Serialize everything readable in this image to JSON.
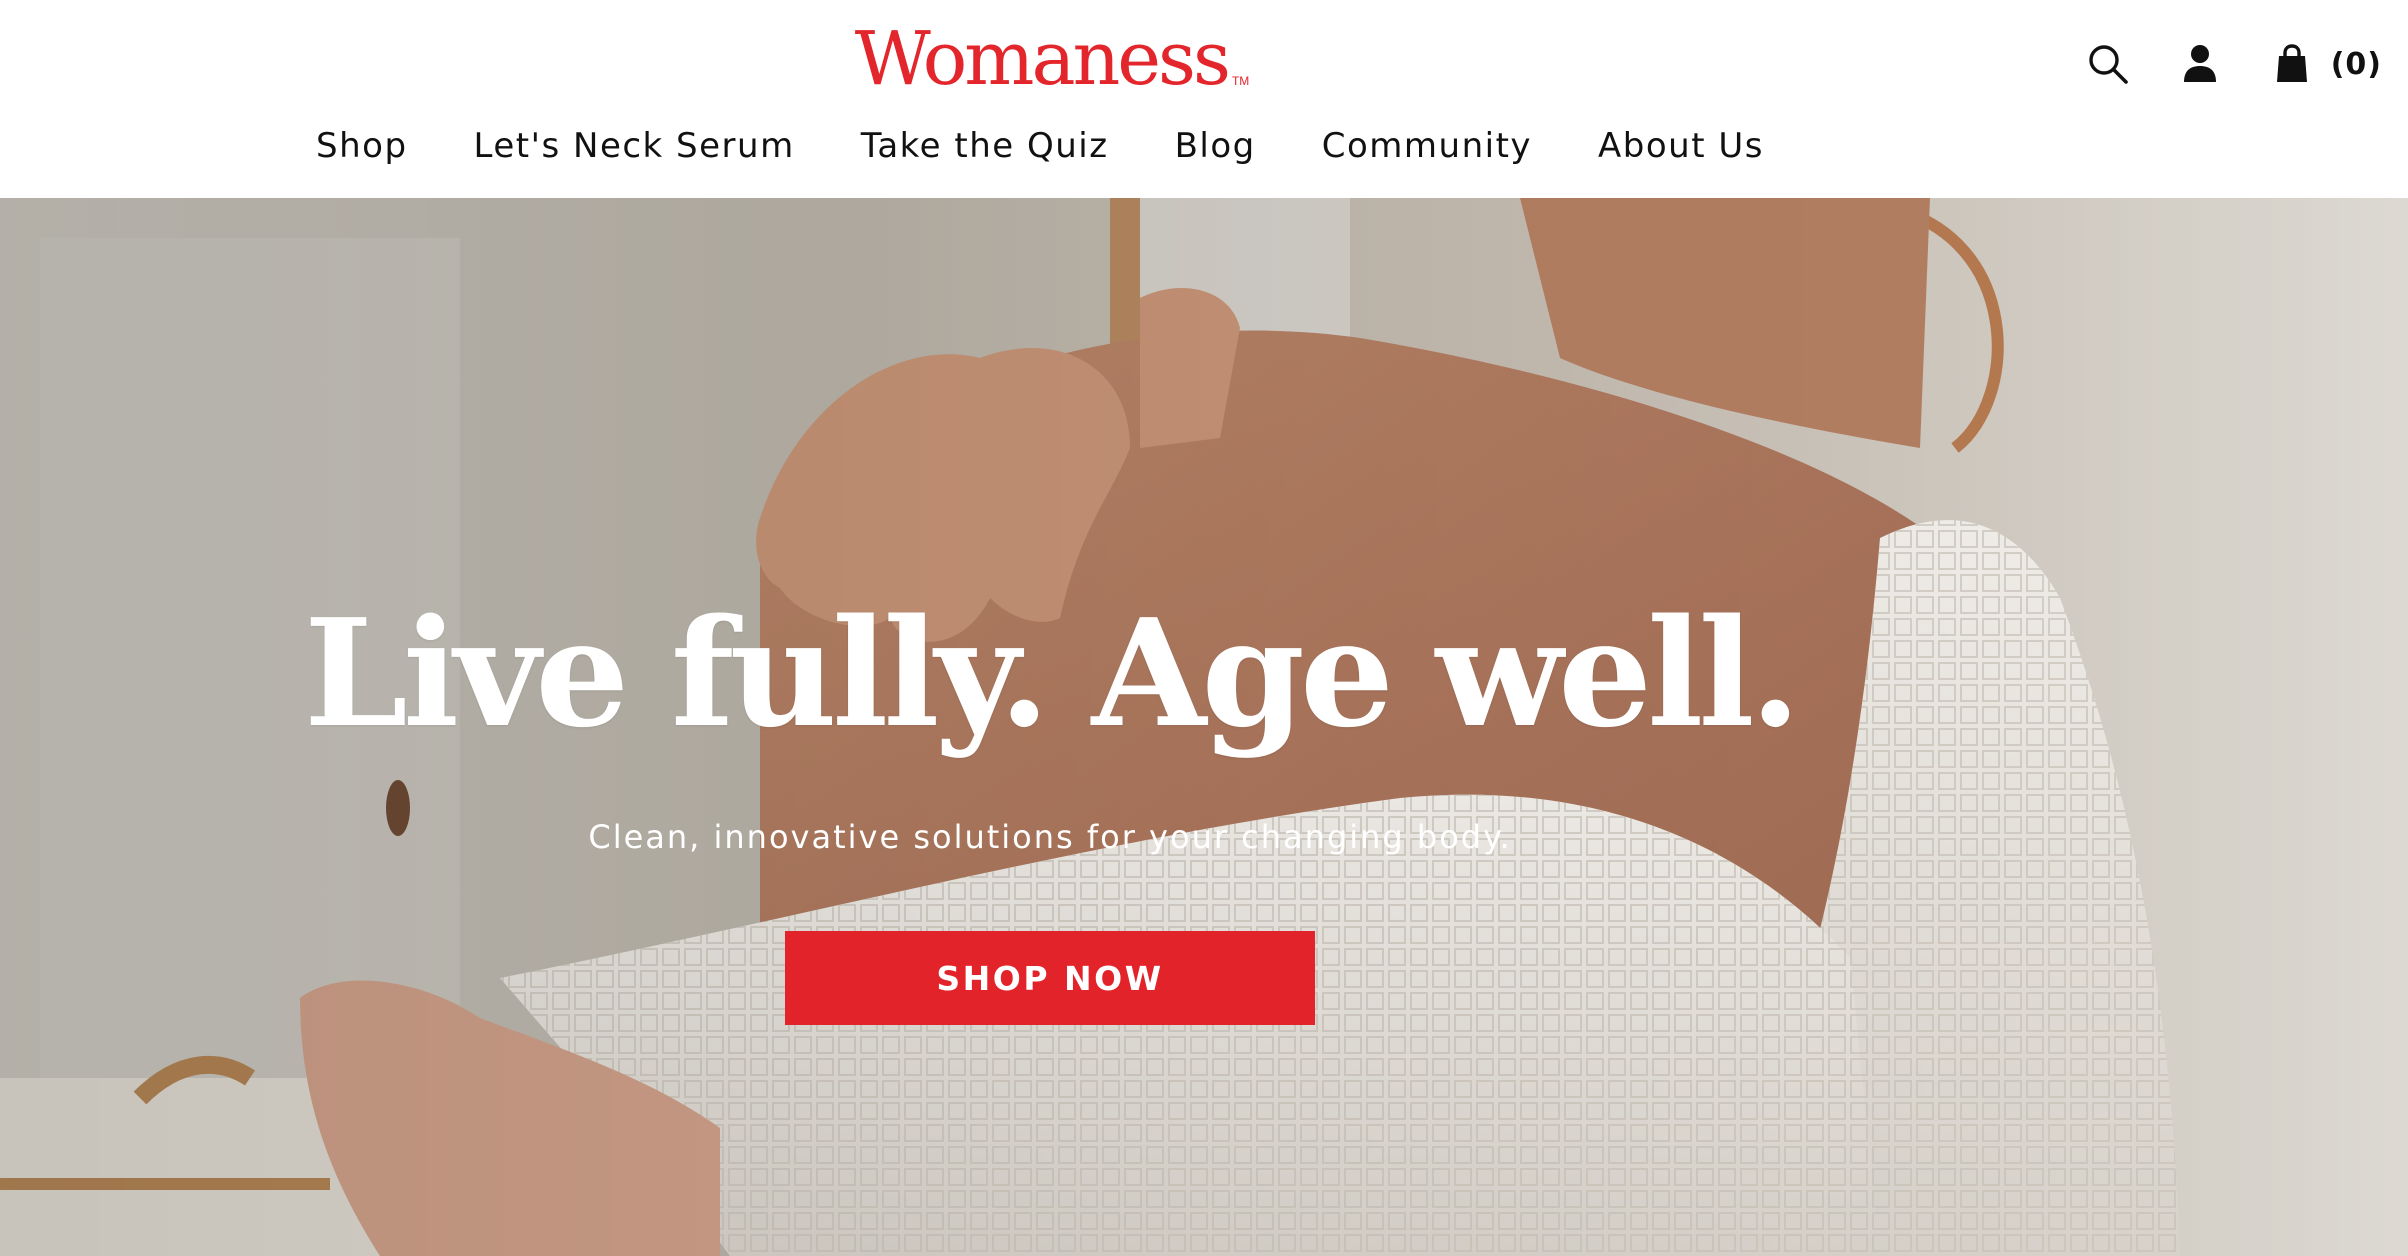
{
  "brand": {
    "logo_text": "Womaness",
    "trademark": "TM",
    "color": "#e3262b"
  },
  "nav": {
    "items": [
      {
        "label": "Shop"
      },
      {
        "label": "Let's Neck Serum"
      },
      {
        "label": "Take the Quiz"
      },
      {
        "label": "Blog"
      },
      {
        "label": "Community"
      },
      {
        "label": "About Us"
      }
    ]
  },
  "utility": {
    "search_icon": "search-icon",
    "account_icon": "user-icon",
    "cart_icon": "shopping-bag-icon",
    "cart_count": "(0)"
  },
  "hero": {
    "headline": "Live fully. Age well.",
    "subheadline": "Clean, innovative solutions for your changing body.",
    "cta_label": "SHOP NOW",
    "cta_color": "#e3232a",
    "text_color": "#ffffff"
  }
}
